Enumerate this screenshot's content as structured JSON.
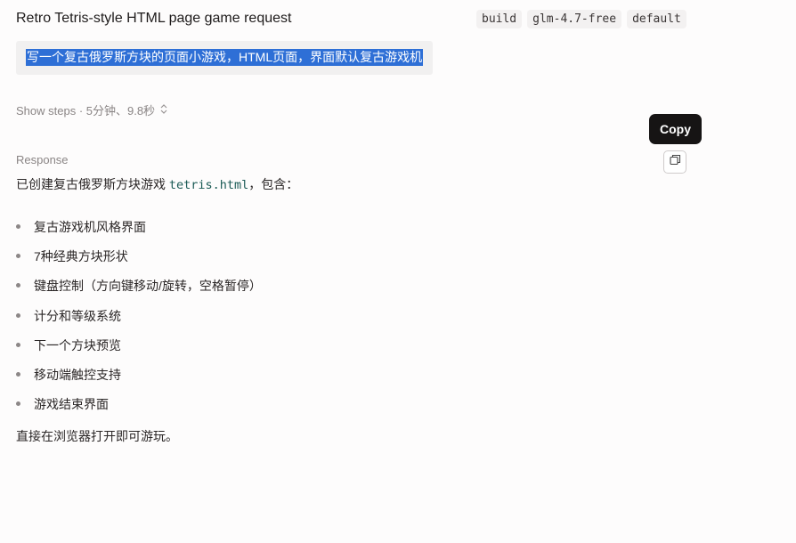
{
  "header": {
    "title": "Retro Tetris-style HTML page game request",
    "tags": [
      "build",
      "glm-4.7-free",
      "default"
    ]
  },
  "prompt": {
    "text": "写一个复古俄罗斯方块的页面小游戏，HTML页面，界面默认复古游戏机"
  },
  "steps": {
    "label": "Show steps · 5分钟、9.8秒",
    "chevron_icon": "chevron-updown-icon"
  },
  "copy": {
    "tooltip": "Copy",
    "icon": "copy-icon"
  },
  "response": {
    "label": "Response",
    "intro_before": "已创建复古俄罗斯方块游戏 ",
    "intro_code": "tetris.html",
    "intro_after": "，包含：",
    "items": [
      "复古游戏机风格界面",
      "7种经典方块形状",
      "键盘控制（方向键移动/旋转，空格暂停）",
      "计分和等级系统",
      "下一个方块预览",
      "移动端触控支持",
      "游戏结束界面"
    ],
    "outro": "直接在浏览器打开即可游玩。"
  }
}
